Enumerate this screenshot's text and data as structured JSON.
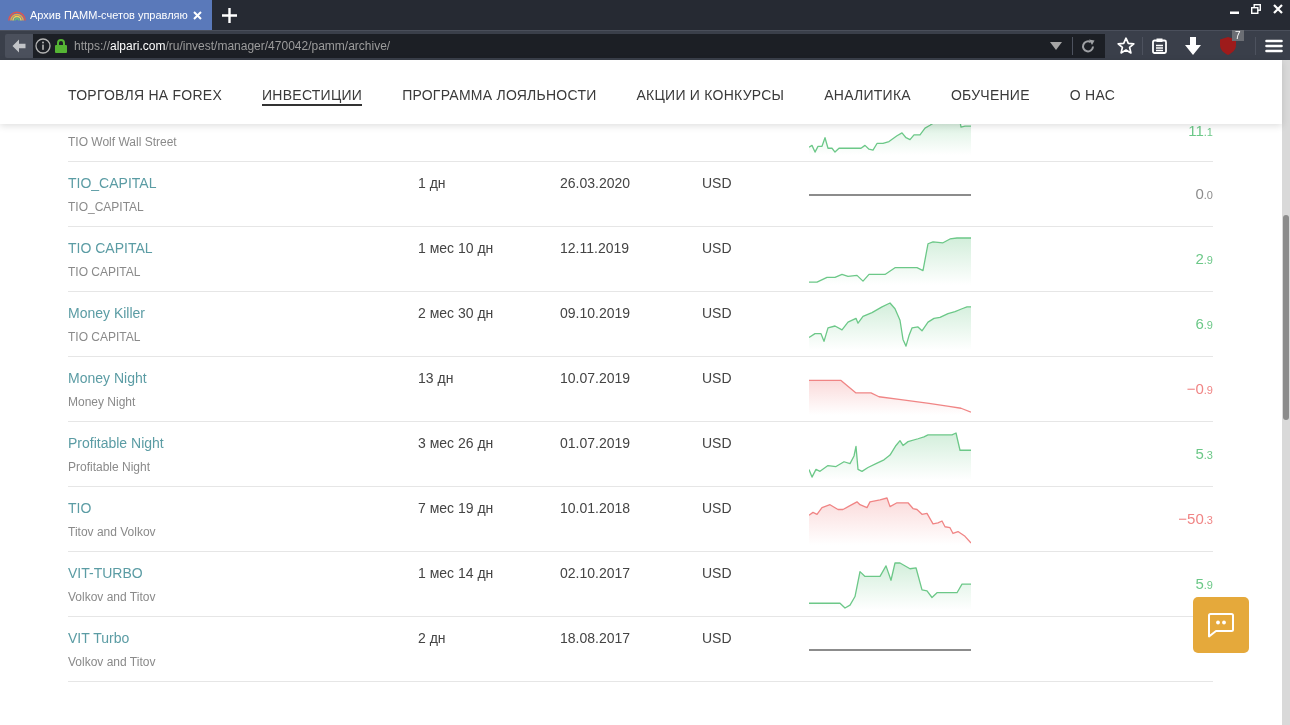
{
  "browser": {
    "tabs": [
      {
        "title": "Архив ПАММ-счетов управляю",
        "selected": true
      }
    ],
    "address": "https://**alpari.com**/ru/invest/manager/470042/pamm/archive/",
    "extension_badge": "7"
  },
  "nav": {
    "items": [
      {
        "label": "ТОРГОВЛЯ НА FOREX",
        "selected": false
      },
      {
        "label": "ИНВЕСТИЦИИ",
        "selected": true
      },
      {
        "label": "ПРОГРАММА ЛОЯЛЬНОСТИ",
        "selected": false
      },
      {
        "label": "АКЦИИ И КОНКУРСЫ",
        "selected": false
      },
      {
        "label": "АНАЛИТИКА",
        "selected": false
      },
      {
        "label": "ОБУЧЕНИЕ",
        "selected": false
      },
      {
        "label": "О НАС",
        "selected": false
      }
    ]
  },
  "table": {
    "cut_row": {
      "column_1": {
        "subtitle": "TIO Wolf Wall Street"
      },
      "color": "#6cc888",
      "column_6": "11.1"
    },
    "rows": [
      {
        "column_1": {
          "title": "TIO_CAPITAL",
          "subtitle": "TIO_CAPITAL"
        },
        "column_2": "1 дн",
        "column_3": "26.03.2020",
        "column_4": "USD",
        "color": "#8c8c8c",
        "column_6": "0.0"
      },
      {
        "column_1": {
          "title": "TIO CAPITAL",
          "subtitle": "TIO CAPITAL"
        },
        "column_2": "1 мес 10 дн",
        "column_3": "12.11.2019",
        "column_4": "USD",
        "color": "#6cc888",
        "column_6": "2.9"
      },
      {
        "column_1": {
          "title": "Money Killer",
          "subtitle": "TIO CAPITAL"
        },
        "column_2": "2 мес 30 дн",
        "column_3": "09.10.2019",
        "column_4": "USD",
        "color": "#6cc888",
        "column_6": "6.9"
      },
      {
        "column_1": {
          "title": "Money Night",
          "subtitle": "Money Night"
        },
        "column_2": "13 дн",
        "column_3": "10.07.2019",
        "column_4": "USD",
        "color": "#f08585",
        "column_6": "−0.9"
      },
      {
        "column_1": {
          "title": "Profitable Night",
          "subtitle": "Profitable Night"
        },
        "column_2": "3 мес 26 дн",
        "column_3": "01.07.2019",
        "column_4": "USD",
        "color": "#6cc888",
        "column_6": "5.3"
      },
      {
        "column_1": {
          "title": "TIO",
          "subtitle": "Titov and Volkov"
        },
        "column_2": "7 мес 19 дн",
        "column_3": "10.01.2018",
        "column_4": "USD",
        "color": "#f08585",
        "column_6": "−50.3"
      },
      {
        "column_1": {
          "title": "VIT-TURBO",
          "subtitle": "Volkov and Titov"
        },
        "column_2": "1 мес 14 дн",
        "column_3": "02.10.2017",
        "column_4": "USD",
        "color": "#6cc888",
        "column_6": "5.9"
      },
      {
        "column_1": {
          "title": "VIT Turbo",
          "subtitle": "Volkov and Titov"
        },
        "column_2": "2 дн",
        "column_3": "18.08.2017",
        "column_4": "USD",
        "color": "#8c8c8c"
      }
    ]
  }
}
